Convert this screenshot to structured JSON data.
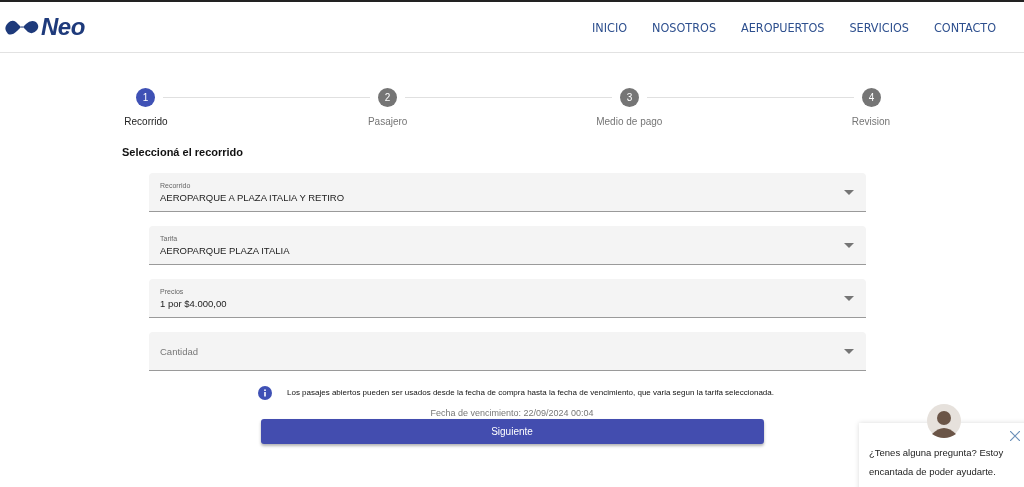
{
  "header": {
    "logo_text": "Neo",
    "nav": [
      {
        "label": "INICIO"
      },
      {
        "label": "NOSOTROS"
      },
      {
        "label": "AEROPUERTOS"
      },
      {
        "label": "SERVICIOS"
      },
      {
        "label": "CONTACTO"
      }
    ]
  },
  "stepper": [
    {
      "number": "1",
      "label": "Recorrido",
      "selected": true
    },
    {
      "number": "2",
      "label": "Pasajero",
      "selected": false
    },
    {
      "number": "3",
      "label": "Medio de pago",
      "selected": false
    },
    {
      "number": "4",
      "label": "Revision",
      "selected": false
    }
  ],
  "heading": "Seleccioná el recorrido",
  "fields": [
    {
      "label": "Recorrido",
      "value": "AEROPARQUE A PLAZA ITALIA Y RETIRO"
    },
    {
      "label": "Tarifa",
      "value": "AEROPARQUE PLAZA ITALIA"
    },
    {
      "label": "Precios",
      "value": "1 por $4.000,00"
    },
    {
      "placeholder": "Cantidad"
    }
  ],
  "info": "Los pasajes abiertos pueden ser usados desde la fecha de compra hasta la fecha de vencimiento, que varia segun la tarifa seleccionada.",
  "expiry": "Fecha de vencimiento: 22/09/2024 00:04",
  "button": "Siguiente",
  "chat": {
    "message": "¿Tenes alguna pregunta? Estoy encantada de poder ayudarte."
  }
}
